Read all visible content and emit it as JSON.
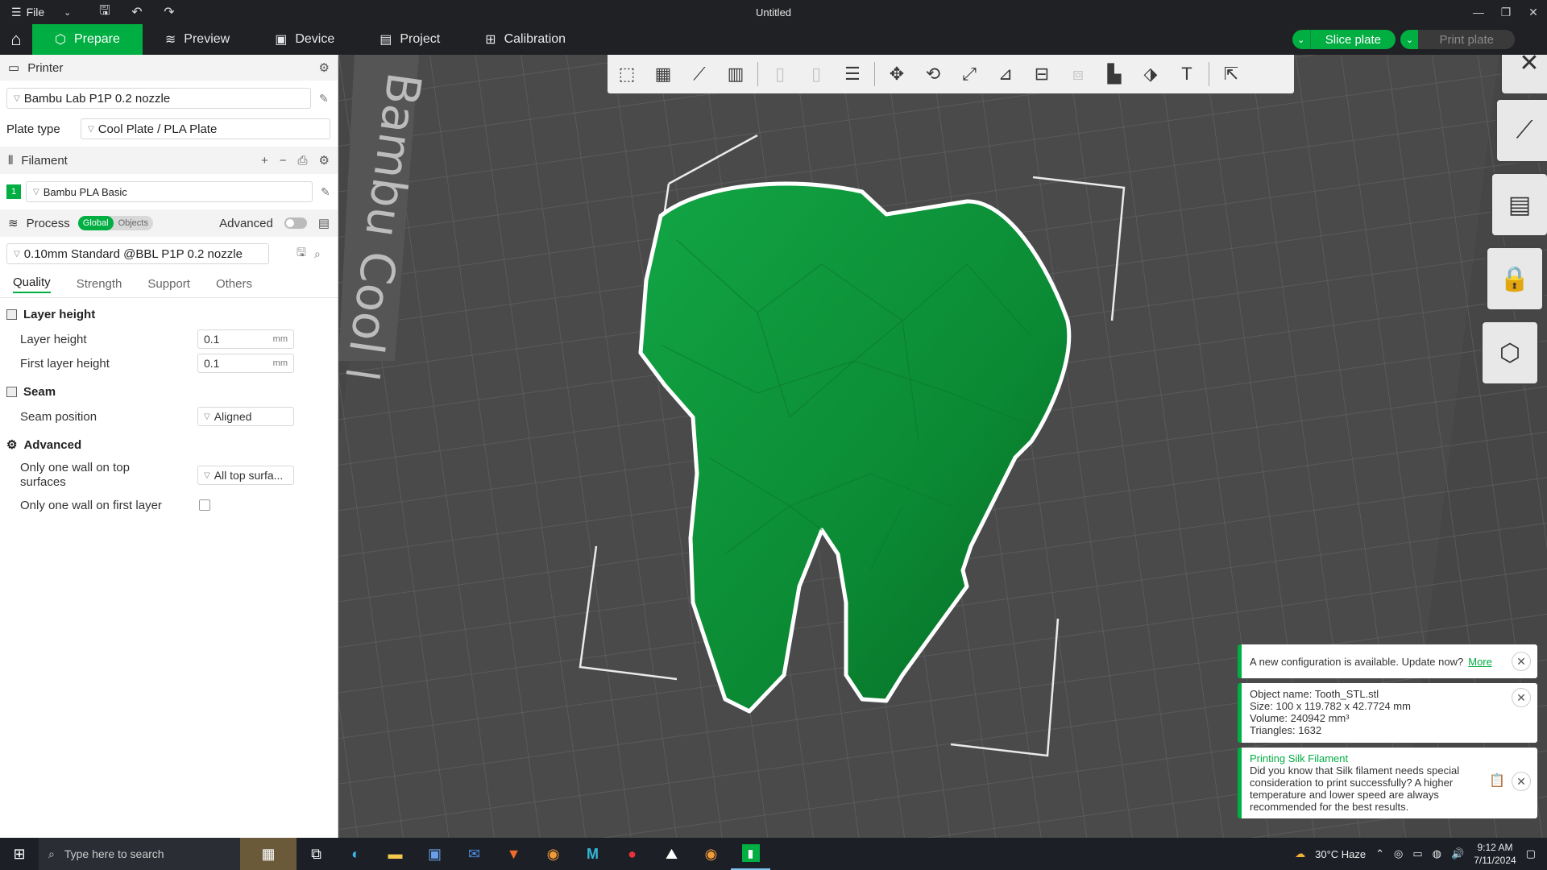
{
  "titlebar": {
    "file_label": "File",
    "title": "Untitled"
  },
  "tabs": [
    {
      "label": "Prepare",
      "icon": "cube-icon"
    },
    {
      "label": "Preview",
      "icon": "layers-icon"
    },
    {
      "label": "Device",
      "icon": "device-icon"
    },
    {
      "label": "Project",
      "icon": "project-icon"
    },
    {
      "label": "Calibration",
      "icon": "calibration-icon"
    }
  ],
  "actions": {
    "slice": "Slice plate",
    "print": "Print plate"
  },
  "printer": {
    "section": "Printer",
    "selected": "Bambu Lab P1P 0.2 nozzle",
    "plate_type_label": "Plate type",
    "plate_type": "Cool Plate / PLA Plate"
  },
  "filament": {
    "section": "Filament",
    "slot": "1",
    "name": "Bambu PLA Basic",
    "color": "#00ae42"
  },
  "process": {
    "section": "Process",
    "toggle_global": "Global",
    "toggle_objects": "Objects",
    "advanced_label": "Advanced",
    "preset": "0.10mm Standard @BBL P1P 0.2 nozzle",
    "subtabs": [
      "Quality",
      "Strength",
      "Support",
      "Others"
    ]
  },
  "quality": {
    "layer_height_group": "Layer height",
    "layer_height_label": "Layer height",
    "layer_height": "0.1",
    "first_layer_height_label": "First layer height",
    "first_layer_height": "0.1",
    "unit": "mm",
    "seam_group": "Seam",
    "seam_position_label": "Seam position",
    "seam_position": "Aligned",
    "advanced_group": "Advanced",
    "one_wall_top_label": "Only one wall on top surfaces",
    "one_wall_top": "All top surfa...",
    "one_wall_first_label": "Only one wall on first layer"
  },
  "plate_label": "Bambu Cool Plate",
  "notifications": {
    "update_text": "A new configuration is available. Update now?",
    "update_link": "More",
    "object_name": "Object name: Tooth_STL.stl",
    "object_size": "Size: 100 x 119.782 x 42.7724 mm",
    "object_volume": "Volume: 240942 mm³",
    "object_triangles": "Triangles: 1632",
    "tip_title": "Printing Silk Filament",
    "tip_body": "Did you know that Silk filament needs special consideration to print successfully? A higher temperature and lower speed are always recommended for the best results."
  },
  "taskbar": {
    "search_placeholder": "Type here to search",
    "weather": "30°C  Haze",
    "time": "9:12 AM",
    "date": "7/11/2024"
  },
  "colors": {
    "accent": "#00ae42",
    "model": "#0e8a32"
  }
}
